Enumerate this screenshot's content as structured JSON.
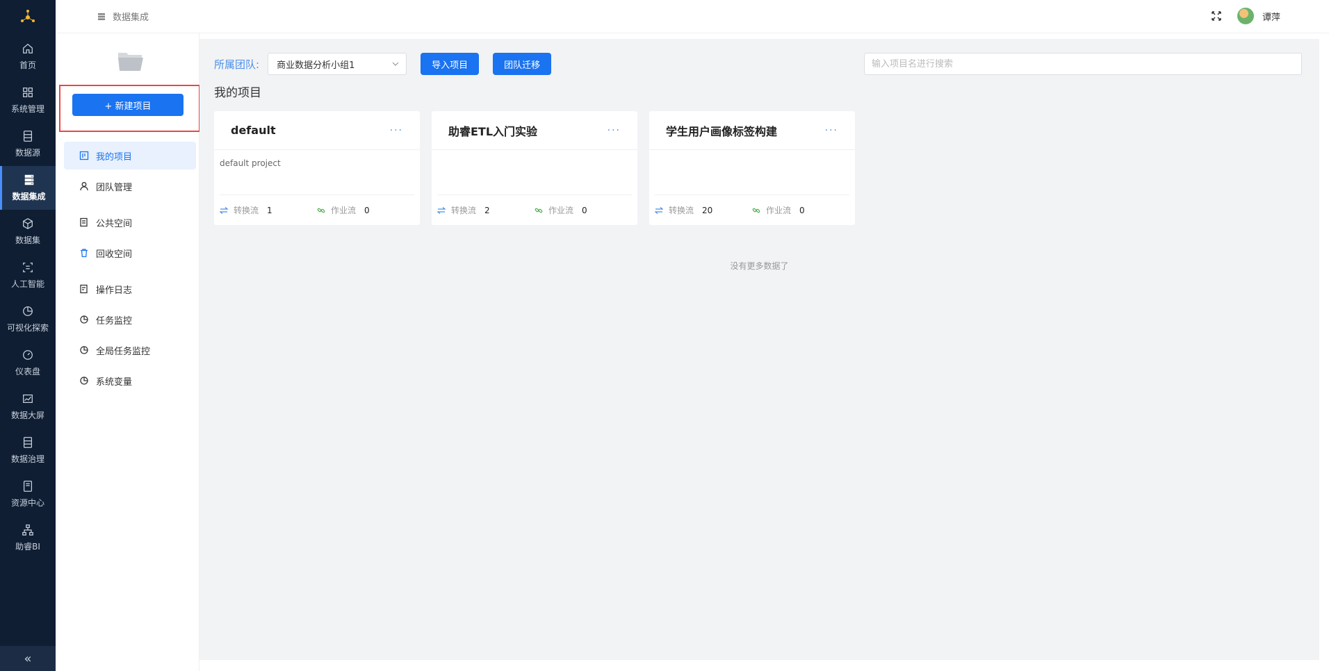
{
  "rail": {
    "items": [
      {
        "label": "首页",
        "icon": "home-icon"
      },
      {
        "label": "系统管理",
        "icon": "grid-icon"
      },
      {
        "label": "数据源",
        "icon": "database-icon"
      },
      {
        "label": "数据集成",
        "icon": "server-icon",
        "active": true
      },
      {
        "label": "数据集",
        "icon": "cube-icon"
      },
      {
        "label": "人工智能",
        "icon": "scan-icon"
      },
      {
        "label": "可视化探索",
        "icon": "pie-icon"
      },
      {
        "label": "仪表盘",
        "icon": "gauge-icon"
      },
      {
        "label": "数据大屏",
        "icon": "chart-icon"
      },
      {
        "label": "数据治理",
        "icon": "document-icon"
      },
      {
        "label": "资源中心",
        "icon": "file-icon"
      },
      {
        "label": "助睿BI",
        "icon": "hierarchy-icon"
      }
    ],
    "collapse_glyph": "«"
  },
  "header": {
    "breadcrumb": "数据集成",
    "username": "谭萍"
  },
  "side": {
    "new_project_label": "+ 新建项目",
    "menu": [
      {
        "label": "我的项目",
        "icon": "board-icon",
        "active": true
      },
      {
        "label": "团队管理",
        "icon": "user-icon"
      },
      {
        "label": "公共空间",
        "icon": "notes-icon"
      },
      {
        "label": "回收空间",
        "icon": "trash-icon"
      },
      {
        "label": "操作日志",
        "icon": "log-icon"
      },
      {
        "label": "任务监控",
        "icon": "pie-icon"
      },
      {
        "label": "全局任务监控",
        "icon": "pie-icon"
      },
      {
        "label": "系统变量",
        "icon": "pie-icon"
      }
    ]
  },
  "main": {
    "team_label": "所属团队:",
    "team_value": "商业数据分析小组1",
    "import_label": "导入项目",
    "migrate_label": "团队迁移",
    "search_placeholder": "输入项目名进行搜索",
    "section_title": "我的项目",
    "no_more": "没有更多数据了",
    "cards": [
      {
        "title": "default",
        "desc": "default project",
        "transform_label": "转换流",
        "transform_count": "1",
        "job_label": "作业流",
        "job_count": "0"
      },
      {
        "title": "助睿ETL入门实验",
        "desc": "",
        "transform_label": "转换流",
        "transform_count": "2",
        "job_label": "作业流",
        "job_count": "0"
      },
      {
        "title": "学生用户画像标签构建",
        "desc": "",
        "transform_label": "转换流",
        "transform_count": "20",
        "job_label": "作业流",
        "job_count": "0"
      }
    ],
    "more_glyph": "···"
  },
  "colors": {
    "accent": "#1a73f0",
    "rail_bg": "#0f1e33",
    "highlight_box": "#ee4444"
  }
}
